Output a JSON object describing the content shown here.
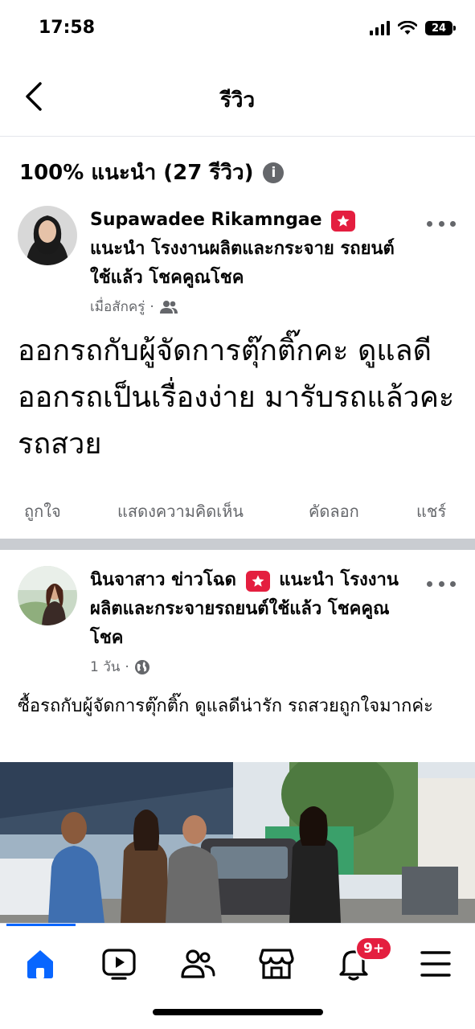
{
  "status_bar": {
    "time": "17:58",
    "battery": "24"
  },
  "header": {
    "title": "รีวิว"
  },
  "summary": {
    "text": "100% แนะนำ (27 รีวิว)",
    "info_icon": "info-icon"
  },
  "posts": [
    {
      "author": "Supawadee Rikamngae",
      "recommend_text": "แนะนำ โรงงานผลิตและกระจาย รถยนต์ใช้แล้ว โชคคูณโชค",
      "timestamp": "เมื่อสักครู่",
      "audience_icon": "friends-icon",
      "body": "ออกรถกับผู้จัดการตุ๊กติ๊กคะ ดูแลดี ออกรถเป็นเรื่องง่าย มารับรถแล้วคะ รถสวย",
      "actions": {
        "like": "ถูกใจ",
        "comment": "แสดงความคิดเห็น",
        "copy": "คัดลอก",
        "share": "แชร์"
      }
    },
    {
      "author": "นินจาสาว ข่าวโฉด",
      "recommend_text": "แนะนำ โรงงานผลิตและกระจายรถยนต์ใช้แล้ว โชคคูณโชค",
      "timestamp": "1 วัน",
      "audience_icon": "globe-icon",
      "body": "ซื้อรถกับผู้จัดการตุ๊กติ๊ก ดูแลดีน่ารัก รถสวยถูกใจมากค่ะ"
    }
  ],
  "bottom_nav": {
    "items": [
      "home-icon",
      "video-icon",
      "friends-icon",
      "marketplace-icon",
      "notifications-icon",
      "menu-icon"
    ],
    "notification_badge": "9+"
  },
  "colors": {
    "accent": "#0866ff",
    "badge": "#e41e3f",
    "secondary_text": "#65676b"
  }
}
